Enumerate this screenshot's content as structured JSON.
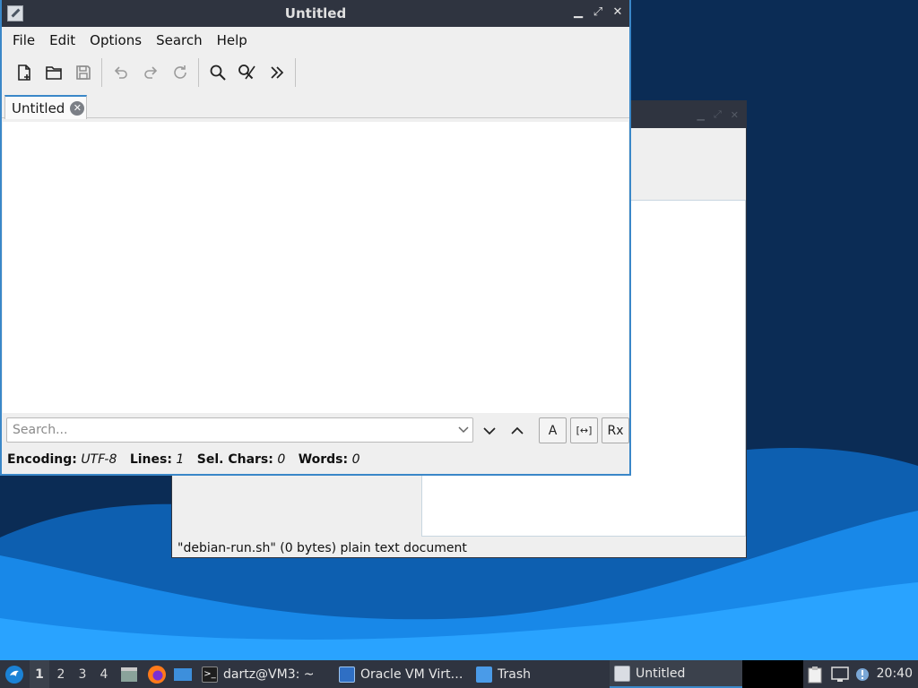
{
  "window": {
    "title": "Untitled",
    "controls": {
      "minimize": "▁",
      "maximize": "⤢",
      "close": "✕"
    }
  },
  "menubar": {
    "items": [
      "File",
      "Edit",
      "Options",
      "Search",
      "Help"
    ]
  },
  "toolbar": {
    "icons": [
      "new-document-icon",
      "open-folder-icon",
      "save-icon",
      "undo-icon",
      "redo-icon",
      "reload-icon",
      "find-icon",
      "find-replace-icon",
      "more-icon"
    ]
  },
  "tabs": [
    {
      "label": "Untitled",
      "close": "✕"
    }
  ],
  "findbar": {
    "placeholder": "Search...",
    "case_label": "A",
    "whole_word_label": "[↔]",
    "regex_label": "Rx"
  },
  "status": {
    "encoding_label": "Encoding:",
    "encoding_value": "UTF-8",
    "lines_label": "Lines:",
    "lines_value": "1",
    "selchars_label": "Sel. Chars:",
    "selchars_value": "0",
    "words_label": "Words:",
    "words_value": "0"
  },
  "background_window": {
    "status_text": "\"debian-run.sh\" (0 bytes) plain text document",
    "controls": {
      "minimize": "▁",
      "maximize": "⤢",
      "close": "✕"
    }
  },
  "taskbar": {
    "workspaces": [
      "1",
      "2",
      "3",
      "4"
    ],
    "tasks": [
      {
        "label": "dartz@VM3: ~",
        "icon": "terminal-icon"
      },
      {
        "label": "Oracle VM Virt…",
        "icon": "virtualbox-icon"
      },
      {
        "label": "Trash",
        "icon": "folder-icon"
      },
      {
        "label": "Untitled",
        "icon": "text-editor-icon"
      }
    ],
    "clock": "20:40"
  },
  "colors": {
    "accent": "#3a87c8",
    "titlebar": "#2f3440",
    "desktop": "#0a2b52",
    "wave": "#1e8ef0"
  }
}
